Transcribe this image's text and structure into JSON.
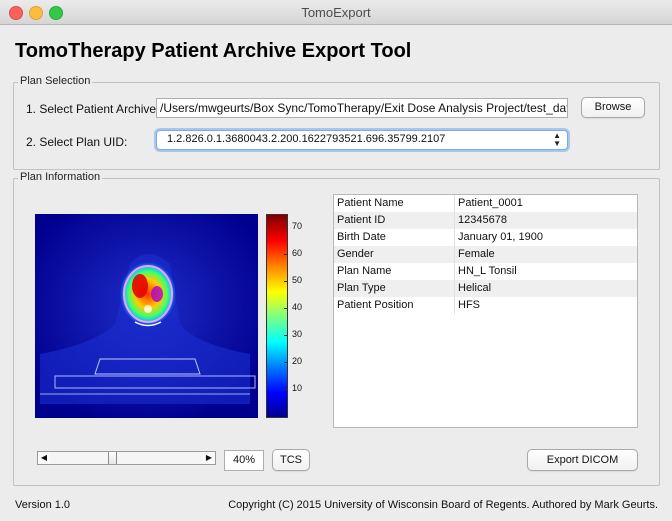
{
  "window": {
    "title": "TomoExport"
  },
  "app": {
    "title": "TomoTherapy Patient Archive Export Tool"
  },
  "plan_selection": {
    "legend": "Plan Selection",
    "archive_label": "1. Select Patient Archive:",
    "archive_value": "/Users/mwgeurts/Box Sync/TomoTherapy/Exit Dose Analysis Project/test_data/Pati",
    "browse_label": "Browse",
    "uid_label": "2. Select Plan UID:",
    "uid_value": "1.2.826.0.1.3680043.2.200.1622793521.696.35799.2107"
  },
  "plan_information": {
    "legend": "Plan Information",
    "colorbar_ticks": [
      "70",
      "60",
      "50",
      "40",
      "30",
      "20",
      "10"
    ],
    "slider_value_percent": 40,
    "zoom_text": "40%",
    "tcs_label": "TCS",
    "export_label": "Export DICOM",
    "rows": [
      {
        "key": "Patient Name",
        "value": "Patient_0001"
      },
      {
        "key": "Patient ID",
        "value": "12345678"
      },
      {
        "key": "Birth Date",
        "value": "January 01, 1900"
      },
      {
        "key": "Gender",
        "value": "Female"
      },
      {
        "key": "Plan Name",
        "value": "HN_L Tonsil"
      },
      {
        "key": "Plan Type",
        "value": "Helical"
      },
      {
        "key": "Patient Position",
        "value": "HFS"
      }
    ]
  },
  "footer": {
    "version": "Version 1.0",
    "copyright": "Copyright (C) 2015 University of Wisconsin Board of Regents. Authored by Mark Geurts."
  },
  "icons": [
    "close-icon",
    "minimize-icon",
    "zoom-icon",
    "updown-arrows-icon",
    "left-arrow-icon",
    "right-arrow-icon"
  ]
}
